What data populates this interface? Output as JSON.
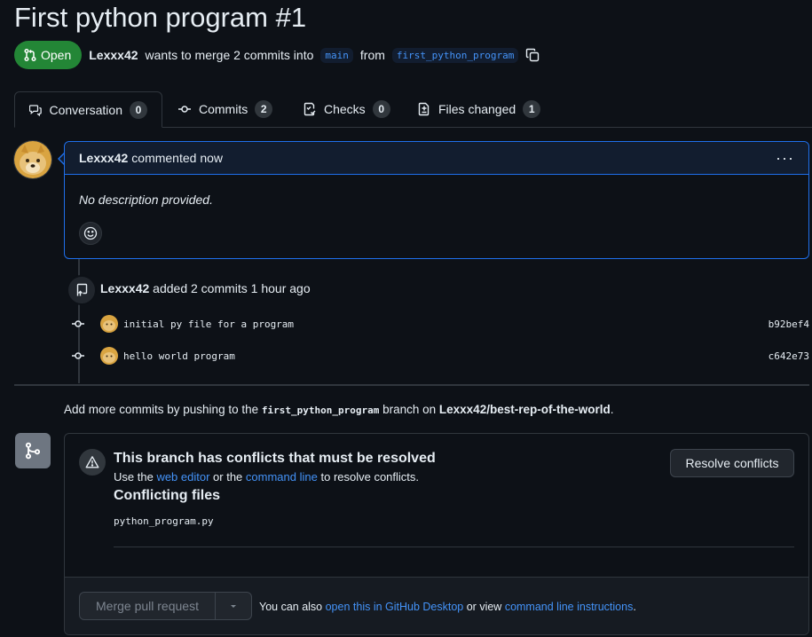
{
  "pr": {
    "title": "First python program #1",
    "state": "Open",
    "author": "Lexxx42",
    "summary": "wants to merge 2 commits into",
    "base_branch": "main",
    "from_word": "from",
    "head_branch": "first_python_program"
  },
  "tabs": [
    {
      "label": "Conversation",
      "count": "0"
    },
    {
      "label": "Commits",
      "count": "2"
    },
    {
      "label": "Checks",
      "count": "0"
    },
    {
      "label": "Files changed",
      "count": "1"
    }
  ],
  "comment": {
    "author": "Lexxx42",
    "action": "commented now",
    "body": "No description provided."
  },
  "push_event": {
    "author": "Lexxx42",
    "text": "added 2 commits 1 hour ago"
  },
  "commits": [
    {
      "message": "initial py file for a program",
      "sha": "b92bef4"
    },
    {
      "message": "hello world program",
      "sha": "c642e73"
    }
  ],
  "hint": {
    "prefix": "Add more commits by pushing to the",
    "branch": "first_python_program",
    "middle": "branch on",
    "repo": "Lexxx42/best-rep-of-the-world",
    "suffix": "."
  },
  "merge": {
    "conflict_title": "This branch has conflicts that must be resolved",
    "desc_prefix": "Use the",
    "web_editor": "web editor",
    "desc_mid": "or the",
    "command_line": "command line",
    "desc_suffix": "to resolve conflicts.",
    "files_title": "Conflicting files",
    "files": [
      "python_program.py"
    ],
    "resolve_label": "Resolve conflicts",
    "merge_label": "Merge pull request",
    "also_prefix": "You can also",
    "open_desktop": "open this in GitHub Desktop",
    "also_mid": "or view",
    "cli_instructions": "command line instructions",
    "also_suffix": "."
  },
  "colors": {
    "background": "#0d1117",
    "open_green": "#238636",
    "link_blue": "#4493f8",
    "focus_blue": "#1f6feb",
    "border": "#30363d"
  }
}
